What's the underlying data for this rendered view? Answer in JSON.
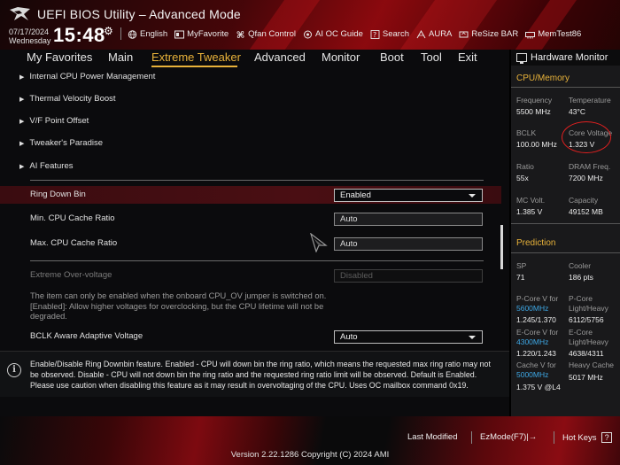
{
  "header": {
    "title": "UEFI BIOS Utility – Advanced Mode",
    "date": "07/17/2024",
    "day": "Wednesday",
    "time": "15:48",
    "toolbar": [
      {
        "label": "English",
        "icon": "globe-icon"
      },
      {
        "label": "MyFavorite",
        "icon": "favorite-icon"
      },
      {
        "label": "Qfan Control",
        "icon": "fan-icon"
      },
      {
        "label": "AI OC Guide",
        "icon": "ai-icon"
      },
      {
        "label": "Search",
        "icon": "search-icon"
      },
      {
        "label": "AURA",
        "icon": "aura-icon"
      },
      {
        "label": "ReSize BAR",
        "icon": "resize-bar-icon"
      },
      {
        "label": "MemTest86",
        "icon": "memtest-icon"
      }
    ]
  },
  "nav": {
    "tabs": [
      "My Favorites",
      "Main",
      "Extreme Tweaker",
      "Advanced",
      "Monitor",
      "Boot",
      "Tool",
      "Exit"
    ],
    "active": "Extreme Tweaker"
  },
  "submenus": [
    "Internal CPU Power Management",
    "Thermal Velocity Boost",
    "V/F Point Offset",
    "Tweaker's Paradise",
    "AI Features"
  ],
  "settings": {
    "ring_down_bin": {
      "label": "Ring Down Bin",
      "value": "Enabled"
    },
    "min_cpu_cache_ratio": {
      "label": "Min. CPU Cache Ratio",
      "value": "Auto"
    },
    "max_cpu_cache_ratio": {
      "label": "Max. CPU Cache Ratio",
      "value": "Auto"
    },
    "extreme_overvoltage": {
      "label": "Extreme Over-voltage",
      "value": "Disabled"
    },
    "extreme_overvoltage_note_1": "The item can only be enabled when the onboard CPU_OV jumper is switched on.",
    "extreme_overvoltage_note_2": "[Enabled]: Allow higher voltages for overclocking, but the CPU lifetime will not be",
    "extreme_overvoltage_note_3": "degraded.",
    "bclk_aware_adaptive_voltage": {
      "label": "BCLK Aware Adaptive Voltage",
      "value": "Auto"
    }
  },
  "help": {
    "line1": "Enable/Disable Ring Downbin feature. Enabled - CPU will down bin the ring ratio, which means the requested max ring ratio may not",
    "line2": "be observed. Disable - CPU will not down bin the ring ratio and the requested ring ratio limit will be observed. Default is Enabled.",
    "line3": "Please use caution when disabling this feature as it may result in overvoltaging of the CPU. Uses OC mailbox command 0x19."
  },
  "hardware_monitor": {
    "title": "Hardware Monitor",
    "cpu_memory_title": "CPU/Memory",
    "frequency_label": "Frequency",
    "frequency_value": "5500 MHz",
    "temperature_label": "Temperature",
    "temperature_value": "43°C",
    "bclk_label": "BCLK",
    "bclk_value": "100.00 MHz",
    "core_voltage_label": "Core Voltage",
    "core_voltage_value": "1.323 V",
    "ratio_label": "Ratio",
    "ratio_value": "55x",
    "dram_freq_label": "DRAM Freq.",
    "dram_freq_value": "7200 MHz",
    "mc_volt_label": "MC Volt.",
    "mc_volt_value": "1.385 V",
    "capacity_label": "Capacity",
    "capacity_value": "49152 MB",
    "prediction_title": "Prediction",
    "sp_label": "SP",
    "sp_value": "71",
    "cooler_label": "Cooler",
    "cooler_value": "186 pts",
    "pcore_v_label": "P-Core V for",
    "pcore_v_freq": "5600MHz",
    "pcore_v_value": "1.245/1.370",
    "pcore_lh_label_1": "P-Core",
    "pcore_lh_label_2": "Light/Heavy",
    "pcore_lh_value": "6112/5756",
    "ecore_v_label": "E-Core V for",
    "ecore_v_freq": "4300MHz",
    "ecore_v_value": "1.220/1.243",
    "ecore_lh_label_1": "E-Core",
    "ecore_lh_label_2": "Light/Heavy",
    "ecore_lh_value": "4638/4311",
    "cache_v_label": "Cache V for",
    "cache_v_freq": "5000MHz",
    "cache_v_value": "1.375 V @L4",
    "heavy_cache_label": "Heavy Cache",
    "heavy_cache_value": "5017 MHz"
  },
  "footer": {
    "last_modified": "Last Modified",
    "ezmode": "EzMode(F7)|→",
    "hotkeys": "Hot Keys",
    "hotkeys_key": "?",
    "version": "Version 2.22.1286 Copyright (C) 2024 AMI"
  },
  "colors": {
    "accent": "#e8b23a",
    "selection": "#4a0e13",
    "prediction_freq": "#3ea8e6",
    "annotation": "#e02020"
  }
}
